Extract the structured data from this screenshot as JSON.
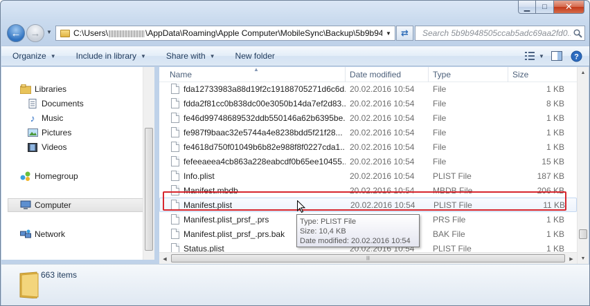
{
  "window": {
    "caption": {
      "minimize": "▁",
      "maximize": "□",
      "close": "✕"
    }
  },
  "nav": {
    "back_icon": "back-arrow-icon",
    "forward_icon": "forward-arrow-icon"
  },
  "address": {
    "path_prefix": "C:\\Users\\",
    "path_suffix": "\\AppData\\Roaming\\Apple Computer\\MobileSync\\Backup\\5b9b94",
    "redacted": true
  },
  "search": {
    "placeholder": "Search 5b9b948505ccab5adc69aa2fd0..."
  },
  "toolbar": {
    "organize": "Organize",
    "include_in_library": "Include in library",
    "share_with": "Share with",
    "new_folder": "New folder"
  },
  "navpane": {
    "libraries": "Libraries",
    "documents": "Documents",
    "music": "Music",
    "pictures": "Pictures",
    "videos": "Videos",
    "homegroup": "Homegroup",
    "computer": "Computer",
    "network": "Network"
  },
  "columns": {
    "name": "Name",
    "date_modified": "Date modified",
    "type": "Type",
    "size": "Size"
  },
  "files": [
    {
      "name": "fda12733983a88d19f2c19188705271d6c6d...",
      "date": "20.02.2016 10:54",
      "type": "File",
      "size": "1 KB"
    },
    {
      "name": "fdda2f81cc0b838dc00e3050b14da7ef2d83...",
      "date": "20.02.2016 10:54",
      "type": "File",
      "size": "8 KB"
    },
    {
      "name": "fe46d99748689532ddb550146a62b6395be...",
      "date": "20.02.2016 10:54",
      "type": "File",
      "size": "1 KB"
    },
    {
      "name": "fe987f9baac32e5744a4e8238bdd5f21f28...",
      "date": "20.02.2016 10:54",
      "type": "File",
      "size": "1 KB"
    },
    {
      "name": "fe4618d750f01049b6b82e988f8f0227cda1...",
      "date": "20.02.2016 10:54",
      "type": "File",
      "size": "1 KB"
    },
    {
      "name": "fefeeaeea4cb863a228eabcdf0b65ee10455...",
      "date": "20.02.2016 10:54",
      "type": "File",
      "size": "15 KB"
    },
    {
      "name": "Info.plist",
      "date": "20.02.2016 10:54",
      "type": "PLIST File",
      "size": "187 KB"
    },
    {
      "name": "Manifest.mbdb",
      "date": "20.02.2016 10:54",
      "type": "MBDB File",
      "size": "206 KB"
    },
    {
      "name": "Manifest.plist",
      "date": "20.02.2016 10:54",
      "type": "PLIST File",
      "size": "11 KB"
    },
    {
      "name": "Manifest.plist_prsf_.prs",
      "date": "20.02.2016 10:54",
      "type": "PRS File",
      "size": "1 KB"
    },
    {
      "name": "Manifest.plist_prsf_.prs.bak",
      "date": "20.02.2016 10:54",
      "type": "BAK File",
      "size": "1 KB"
    },
    {
      "name": "Status.plist",
      "date": "20.02.2016 10:54",
      "type": "PLIST File",
      "size": "1 KB"
    }
  ],
  "hovered_file_index": 8,
  "tooltip": {
    "type": "Type: PLIST File",
    "size": "Size: 10,4 KB",
    "date": "Date modified: 20.02.2016 10:54"
  },
  "details": {
    "item_count": "663 items"
  }
}
